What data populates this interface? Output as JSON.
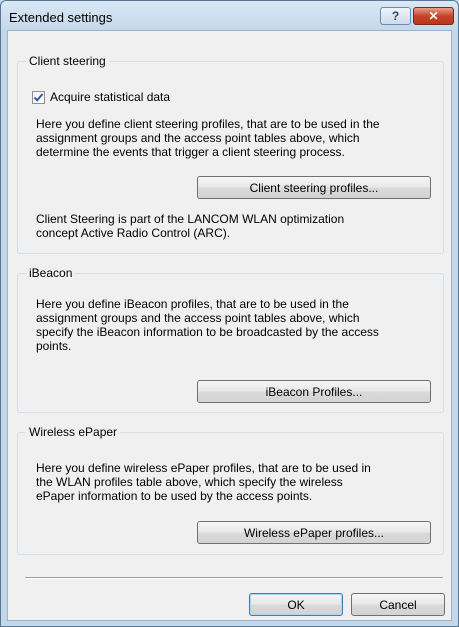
{
  "window": {
    "title": "Extended settings",
    "help_label": "?",
    "close_label": "✕"
  },
  "client_steering": {
    "legend": "Client steering",
    "checkbox_label": "Acquire statistical data",
    "checkbox_checked": true,
    "description_lines": [
      "Here you define client steering profiles, that are to be used in the",
      "assignment groups and the access point tables above, which",
      "determine the events that trigger a client steering process."
    ],
    "button_label": "Client steering profiles...",
    "note_lines": [
      "Client Steering is part of the LANCOM WLAN optimization",
      "concept Active Radio Control (ARC)."
    ]
  },
  "ibeacon": {
    "legend": "iBeacon",
    "description_lines": [
      "Here you define iBeacon profiles, that are to be used in the",
      "assignment groups and the access point tables above, which",
      "specify the iBeacon information to be broadcasted by the access",
      "points."
    ],
    "button_label": "iBeacon Profiles..."
  },
  "epaper": {
    "legend": "Wireless ePaper",
    "description_lines": [
      "Here you define wireless ePaper profiles, that are to be used in",
      "the WLAN profiles table above, which specify the wireless",
      "ePaper information to be used by the access points."
    ],
    "button_label": "Wireless ePaper profiles..."
  },
  "footer": {
    "ok_label": "OK",
    "cancel_label": "Cancel"
  },
  "colors": {
    "checkmark": "#2a5aa8",
    "close_button": "#c7442a"
  }
}
